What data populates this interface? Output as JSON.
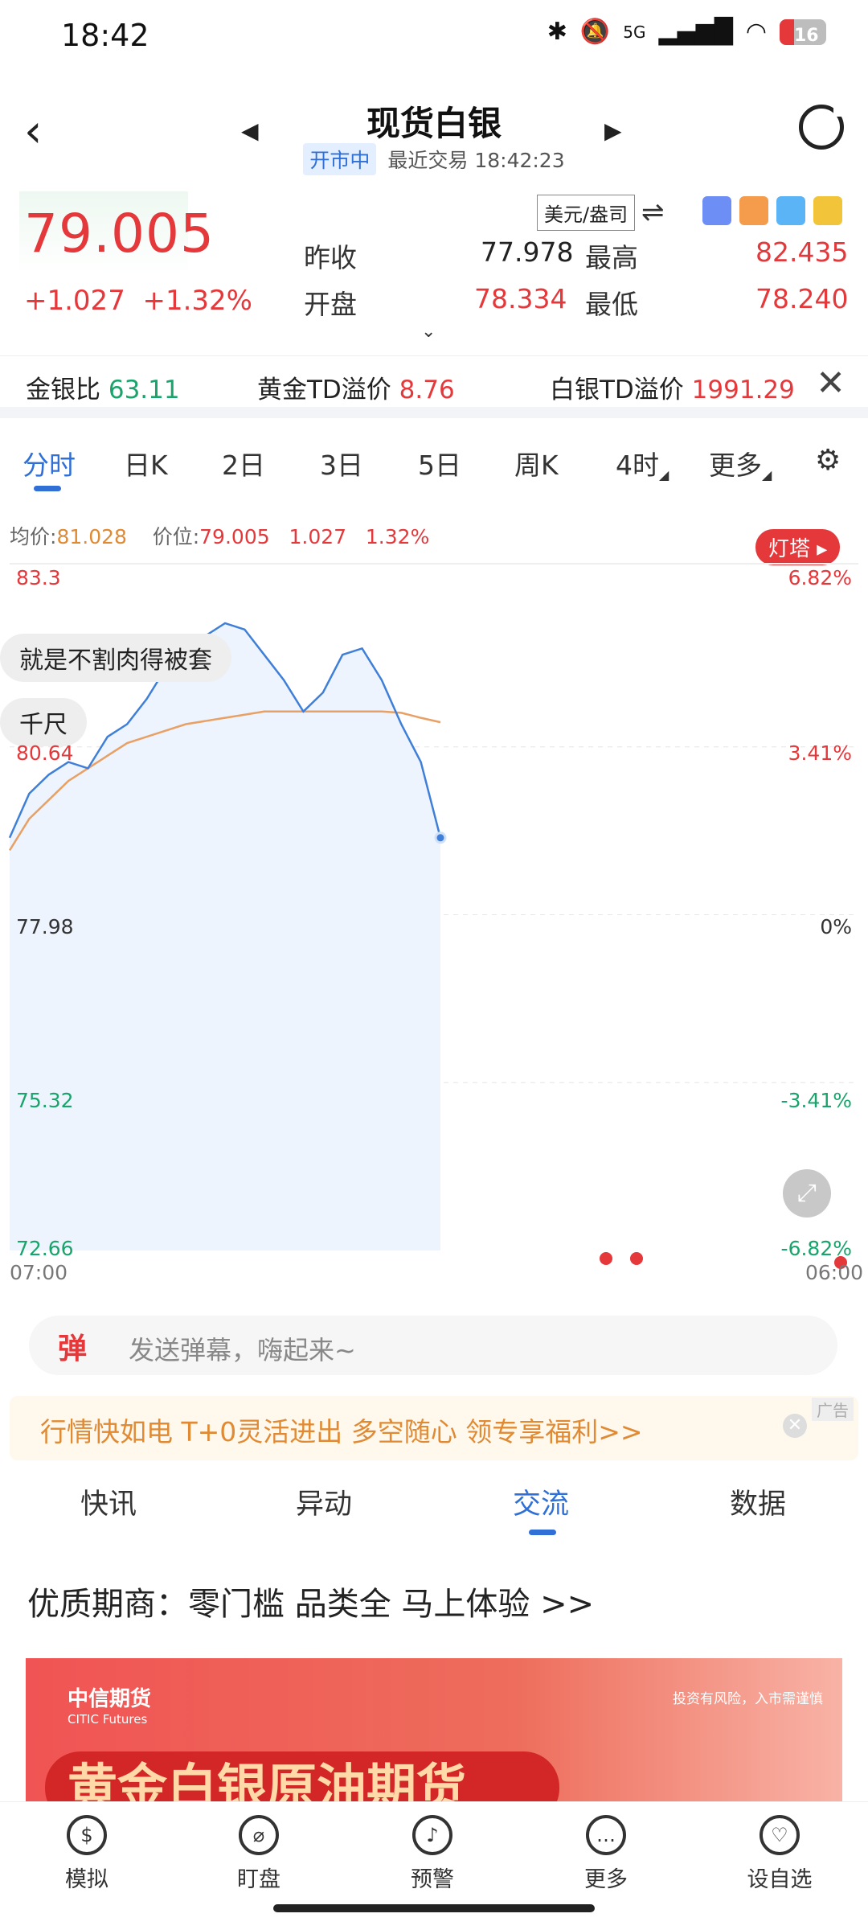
{
  "status_bar": {
    "time": "18:42",
    "battery": "16",
    "network": "5G"
  },
  "header": {
    "title": "现货白银",
    "status_tag": "开市中",
    "last_trade": "最近交易 18:42:23"
  },
  "quote": {
    "price": "79.005",
    "change": "+1.027",
    "change_pct": "+1.32%",
    "unit": "美元/盎司",
    "prev_close_label": "昨收",
    "prev_close": "77.978",
    "open_label": "开盘",
    "open": "78.334",
    "high_label": "最高",
    "high": "82.435",
    "low_label": "最低",
    "low": "78.240"
  },
  "ratio": {
    "gs_label": "金银比",
    "gs_value": "63.11",
    "gold_label": "黄金TD溢价",
    "gold_value": "8.76",
    "silver_label": "白银TD溢价",
    "silver_value": "1991.29"
  },
  "ktabs": [
    "分时",
    "日K",
    "2日",
    "3日",
    "5日",
    "周K",
    "4时",
    "更多"
  ],
  "chart": {
    "avg_label": "均价:",
    "avg_value": "81.028",
    "pos_label": "价位:",
    "pos_value": "79.005",
    "pos_change": "1.027",
    "pos_pct": "1.32%",
    "lighthouse": "灯塔",
    "danmu1": "就是不割肉得被套",
    "danmu2": "千尺",
    "y_left": [
      "83.3",
      "80.64",
      "77.98",
      "75.32",
      "72.66"
    ],
    "y_right": [
      "6.82%",
      "3.41%",
      "0%",
      "-3.41%",
      "-6.82%"
    ],
    "x_start": "07:00",
    "x_end": "06:00"
  },
  "chart_data": {
    "type": "line",
    "series": [
      {
        "values": [
          79.2,
          79.9,
          80.2,
          80.4,
          80.3,
          80.8,
          81.0,
          81.4,
          81.9,
          82.2,
          82.4,
          82.6,
          82.5,
          82.1,
          81.7,
          81.2,
          81.5,
          82.1,
          82.2,
          81.7,
          81.0,
          80.4,
          79.2
        ]
      },
      {
        "values": [
          79.0,
          79.5,
          79.8,
          80.1,
          80.3,
          80.5,
          80.7,
          80.8,
          80.9,
          81.0,
          81.05,
          81.1,
          81.15,
          81.2,
          81.2,
          81.2,
          81.2,
          81.2,
          81.2,
          81.2,
          81.18,
          81.1,
          81.03
        ]
      }
    ],
    "ylim": [
      72.66,
      83.3
    ]
  },
  "danmu_input": {
    "icon": "弹",
    "placeholder": "发送弹幕，嗨起来~"
  },
  "ad": {
    "text": "行情快如电 T+0灵活进出 多空随心 领专享福利>>",
    "label": "广告"
  },
  "content_tabs": [
    "快讯",
    "异动",
    "交流",
    "数据"
  ],
  "promo": {
    "title": "优质期商：零门槛 品类全 马上体验 >>"
  },
  "banner": {
    "logo": "中信期货",
    "logo_en": "CITIC Futures",
    "risk": "投资有风险，入市需谨慎",
    "headline": "黄金白银原油期货"
  },
  "bottom_nav": [
    {
      "label": "模拟",
      "icon": "$"
    },
    {
      "label": "盯盘",
      "icon": "⌀"
    },
    {
      "label": "预警",
      "icon": "♪"
    },
    {
      "label": "更多",
      "icon": "…"
    },
    {
      "label": "设自选",
      "icon": "♡"
    }
  ]
}
